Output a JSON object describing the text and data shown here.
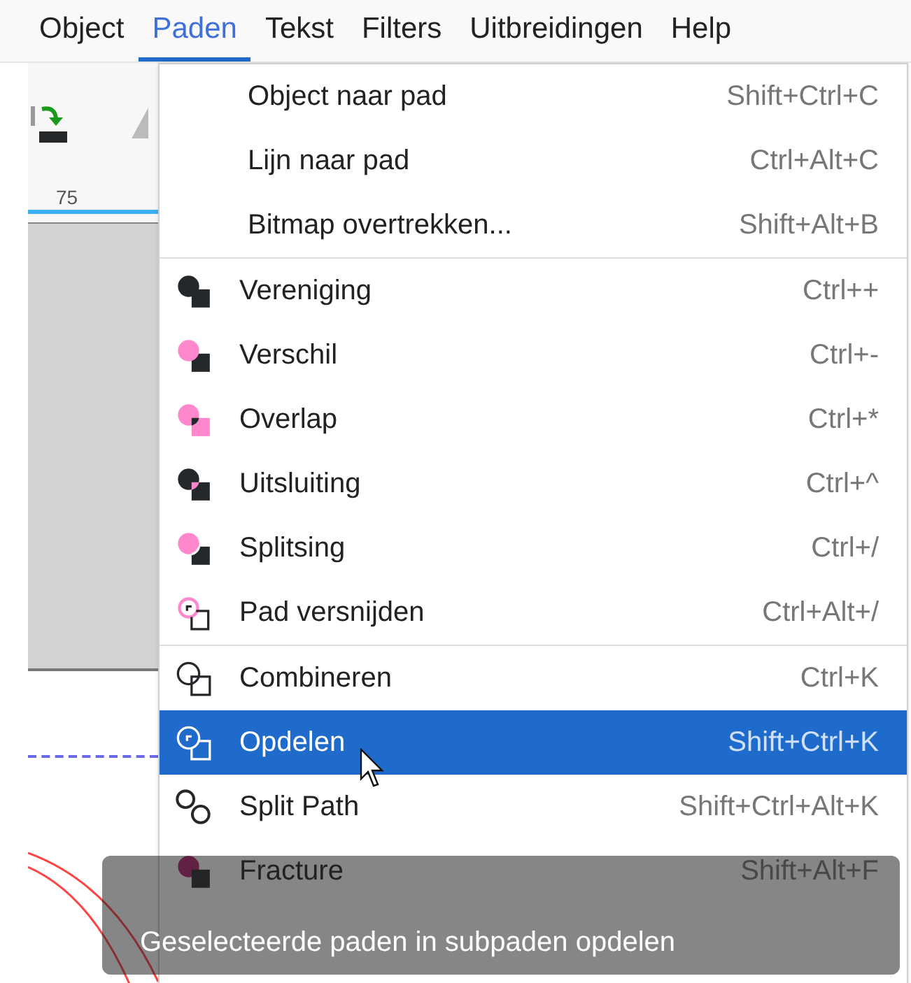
{
  "menubar": [
    {
      "label": "Object",
      "selected": false
    },
    {
      "label": "Paden",
      "selected": true
    },
    {
      "label": "Tekst",
      "selected": false
    },
    {
      "label": "Filters",
      "selected": false
    },
    {
      "label": "Uitbreidingen",
      "selected": false
    },
    {
      "label": "Help",
      "selected": false
    }
  ],
  "ruler": {
    "label": "75"
  },
  "menu": {
    "sections": [
      [
        {
          "label": "Object naar pad",
          "shortcut": "Shift+Ctrl+C",
          "kind": "plain",
          "selected": false
        },
        {
          "label": "Lijn naar pad",
          "shortcut": "Ctrl+Alt+C",
          "kind": "plain",
          "selected": false
        },
        {
          "label": "Bitmap overtrekken...",
          "shortcut": "Shift+Alt+B",
          "kind": "plain",
          "selected": false
        }
      ],
      [
        {
          "label": "Vereniging",
          "shortcut": "Ctrl++",
          "kind": "union",
          "selected": false
        },
        {
          "label": "Verschil",
          "shortcut": "Ctrl+-",
          "kind": "difference",
          "selected": false
        },
        {
          "label": "Overlap",
          "shortcut": "Ctrl+*",
          "kind": "intersection",
          "selected": false
        },
        {
          "label": "Uitsluiting",
          "shortcut": "Ctrl+^",
          "kind": "exclusion",
          "selected": false
        },
        {
          "label": "Splitsing",
          "shortcut": "Ctrl+/",
          "kind": "division",
          "selected": false
        },
        {
          "label": "Pad versnijden",
          "shortcut": "Ctrl+Alt+/",
          "kind": "cut",
          "selected": false
        }
      ],
      [
        {
          "label": "Combineren",
          "shortcut": "Ctrl+K",
          "kind": "combine",
          "selected": false
        },
        {
          "label": "Opdelen",
          "shortcut": "Shift+Ctrl+K",
          "kind": "breakapart",
          "selected": true
        },
        {
          "label": "Split Path",
          "shortcut": "Shift+Ctrl+Alt+K",
          "kind": "split",
          "selected": false
        },
        {
          "label": "Fracture",
          "shortcut": "Shift+Alt+F",
          "kind": "fracture",
          "selected": false
        }
      ]
    ]
  },
  "tooltip": {
    "text": "Geselecteerde paden in subpaden opdelen"
  }
}
